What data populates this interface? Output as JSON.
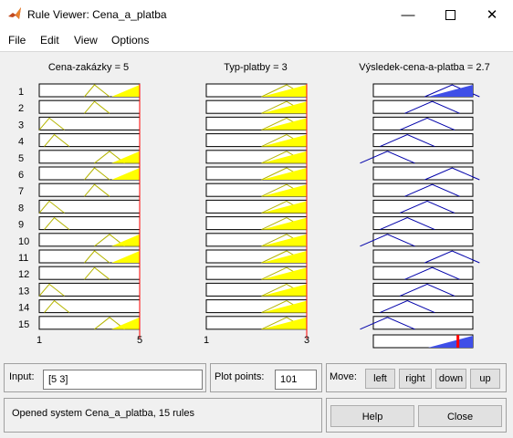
{
  "window": {
    "title": "Rule Viewer: Cena_a_platba"
  },
  "menu": [
    "File",
    "Edit",
    "View",
    "Options"
  ],
  "inputs": [
    {
      "header": "Cena-zakázky = 5",
      "range": [
        1,
        5
      ],
      "value": 5,
      "ticks": [
        "1",
        "5"
      ]
    },
    {
      "header": "Typ-platby = 3",
      "range": [
        1,
        3
      ],
      "value": 3,
      "ticks": [
        "1",
        "3"
      ]
    }
  ],
  "output": {
    "header": "Výsledek-cena-a-platba = 2.7",
    "range": [
      1,
      3
    ],
    "value": 2.7
  },
  "rules": [
    "1",
    "2",
    "3",
    "4",
    "5",
    "6",
    "7",
    "8",
    "9",
    "10",
    "11",
    "12",
    "13",
    "14",
    "15"
  ],
  "input_field": {
    "label": "Input:",
    "value": "[5 3]"
  },
  "plot_points": {
    "label": "Plot points:",
    "value": "101"
  },
  "move": {
    "label": "Move:",
    "buttons": [
      "left",
      "right",
      "down",
      "up"
    ]
  },
  "status": "Opened system Cena_a_platba, 15 rules",
  "buttons": {
    "help": "Help",
    "close": "Close"
  },
  "colors": {
    "fill": "#ffff00",
    "output_fill": "#3f4fe8",
    "mf_input": "#b5b500",
    "mf_output": "#0000aa",
    "indicator": "#ff0000"
  }
}
